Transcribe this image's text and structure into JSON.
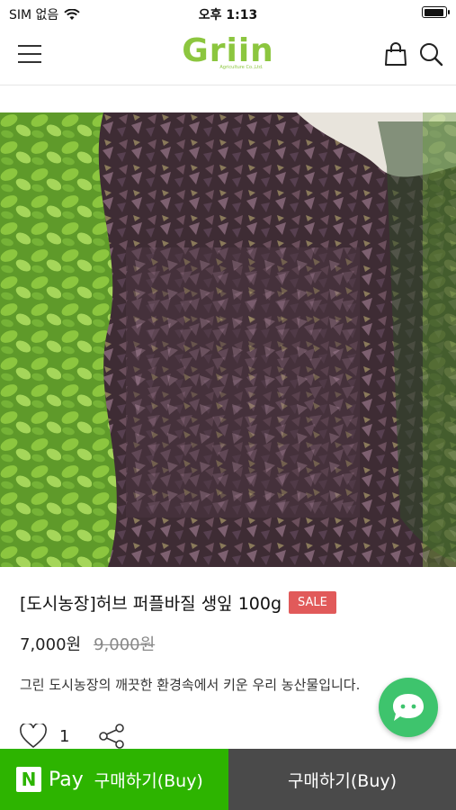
{
  "status_bar": {
    "carrier": "SIM 없음",
    "time": "오후 1:13"
  },
  "header": {
    "logo_text": "Griin",
    "logo_sub": "Agriculture Co.,Ltd."
  },
  "product": {
    "title": "[도시농장]허브 퍼플바질 생잎 100g",
    "badge": "SALE",
    "price": "7,000원",
    "original_price": "9,000원",
    "description": "그린 도시농장의 깨끗한 환경속에서 키운 우리 농산물입니다.",
    "like_count": "1"
  },
  "bottom_bar": {
    "npay_logo": "N",
    "npay_pay": "Pay",
    "npay_label": "구매하기(Buy)",
    "buy_label": "구매하기(Buy)"
  },
  "colors": {
    "brand_green": "#8cc63f",
    "npay_green": "#2db400",
    "sale_red": "#e15a5a",
    "chat_green": "#3ec46d",
    "buy_gray": "#4a4a4a"
  }
}
